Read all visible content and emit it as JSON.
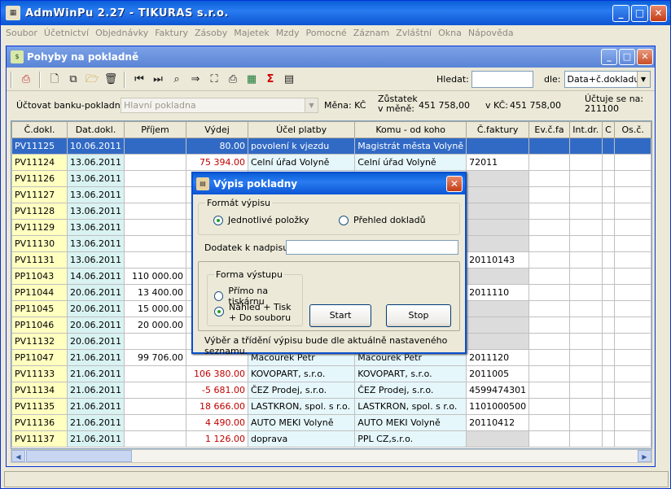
{
  "app": {
    "title": "AdmWinPu 2.27 - TIKURAS  s.r.o."
  },
  "menu": [
    "Soubor",
    "Účetnictví",
    "Objednávky",
    "Faktury",
    "Zásoby",
    "Majetek",
    "Mzdy",
    "Pomocné",
    "Záznam",
    "Zvláštní",
    "Okna",
    "Nápověda"
  ],
  "child": {
    "title": "Pohyby na pokladně"
  },
  "toolbar": {
    "search_label": "Hledat:",
    "search_value": "",
    "sort_label": "dle:",
    "sort_value": "Data+č.dokladu",
    "icons": [
      "print-icon",
      "new-doc-icon",
      "copy-icon",
      "open-folder-icon",
      "delete-icon",
      "first-record-icon",
      "last-record-icon",
      "find-icon",
      "goto-icon",
      "select-area-icon",
      "printer-icon",
      "excel-icon",
      "sum-icon",
      "grid-icon"
    ]
  },
  "info": {
    "account_label": "Účtovat banku-pokladnu:",
    "account_value": "Hlavní pokladna",
    "currency_label": "Měna: KČ",
    "balance_label_1": "Zůstatek",
    "balance_label_2": "v měně:",
    "balance_value": "451 758,00",
    "kc_label": "v KČ:",
    "kc_value": "451 758,00",
    "ucetni_label": "Účtuje se na:",
    "ucetni_value": "211100"
  },
  "table": {
    "columns": [
      "Č.dokl.",
      "Dat.dokl.",
      "Příjem",
      "Výdej",
      "Účel platby",
      "Komu - od koho",
      "Č.faktury",
      "Ev.č.fa",
      "Int.dr.",
      "C",
      "Os.č."
    ],
    "rows": [
      {
        "dokl": "PV11125",
        "dat": "10.06.2011",
        "prijem": "",
        "vydej": "80.00",
        "ucel": "povolení k vjezdu",
        "komu": "Magistrát města Volyně",
        "cf": "",
        "neg": false
      },
      {
        "dokl": "PV11124",
        "dat": "13.06.2011",
        "prijem": "",
        "vydej": "75 394.00",
        "ucel": "Celní úřad Volyně",
        "komu": "Celní úřad Volyně",
        "cf": "72011",
        "neg": true
      },
      {
        "dokl": "PV11126",
        "dat": "13.06.2011",
        "prijem": "",
        "vydej": "",
        "ucel": "",
        "komu": "",
        "cf": "",
        "neg": false
      },
      {
        "dokl": "PV11127",
        "dat": "13.06.2011",
        "prijem": "",
        "vydej": "",
        "ucel": "",
        "komu": "",
        "cf": "",
        "neg": false
      },
      {
        "dokl": "PV11128",
        "dat": "13.06.2011",
        "prijem": "",
        "vydej": "",
        "ucel": "",
        "komu": "",
        "cf": "",
        "neg": false
      },
      {
        "dokl": "PV11129",
        "dat": "13.06.2011",
        "prijem": "",
        "vydej": "",
        "ucel": "",
        "komu": "",
        "cf": "",
        "neg": false
      },
      {
        "dokl": "PV11130",
        "dat": "13.06.2011",
        "prijem": "",
        "vydej": "",
        "ucel": "",
        "komu": "",
        "cf": "",
        "neg": false
      },
      {
        "dokl": "PV11131",
        "dat": "13.06.2011",
        "prijem": "",
        "vydej": "",
        "ucel": "",
        "komu": "",
        "cf": "20110143",
        "neg": false
      },
      {
        "dokl": "PP11043",
        "dat": "14.06.2011",
        "prijem": "110 000.00",
        "vydej": "",
        "ucel": "",
        "komu": "",
        "cf": "",
        "neg": false
      },
      {
        "dokl": "PP11044",
        "dat": "20.06.2011",
        "prijem": "13 400.00",
        "vydej": "",
        "ucel": "",
        "komu": "",
        "cf": "2011110",
        "neg": false
      },
      {
        "dokl": "PP11045",
        "dat": "20.06.2011",
        "prijem": "15 000.00",
        "vydej": "",
        "ucel": "",
        "komu": "",
        "cf": "",
        "neg": false
      },
      {
        "dokl": "PP11046",
        "dat": "20.06.2011",
        "prijem": "20 000.00",
        "vydej": "",
        "ucel": "",
        "komu": "",
        "cf": "",
        "neg": false
      },
      {
        "dokl": "PV11132",
        "dat": "20.06.2011",
        "prijem": "",
        "vydej": "",
        "ucel": "",
        "komu": "",
        "cf": "",
        "neg": false
      },
      {
        "dokl": "PP11047",
        "dat": "21.06.2011",
        "prijem": "99 706.00",
        "vydej": "",
        "ucel": "Macourek Petr",
        "komu": "Macourek Petr",
        "cf": "2011120",
        "neg": false
      },
      {
        "dokl": "PV11133",
        "dat": "21.06.2011",
        "prijem": "",
        "vydej": "106 380.00",
        "ucel": "KOVOPART, s.r.o.",
        "komu": "KOVOPART, s.r.o.",
        "cf": "2011005",
        "neg": true
      },
      {
        "dokl": "PV11134",
        "dat": "21.06.2011",
        "prijem": "",
        "vydej": "-5 681.00",
        "ucel": "ČEZ Prodej, s.r.o.",
        "komu": "ČEZ Prodej, s.r.o.",
        "cf": "4599474301",
        "neg": true
      },
      {
        "dokl": "PV11135",
        "dat": "21.06.2011",
        "prijem": "",
        "vydej": "18 666.00",
        "ucel": "LASTKRON, spol. s r.o.",
        "komu": "LASTKRON, spol. s r.o.",
        "cf": "1101000500",
        "neg": true
      },
      {
        "dokl": "PV11136",
        "dat": "21.06.2011",
        "prijem": "",
        "vydej": "4 490.00",
        "ucel": "AUTO MEKI Volyně",
        "komu": "AUTO MEKI Volyně",
        "cf": "20110412",
        "neg": true
      },
      {
        "dokl": "PV11137",
        "dat": "21.06.2011",
        "prijem": "",
        "vydej": "1 126.00",
        "ucel": "doprava",
        "komu": "PPL CZ,s.r.o.",
        "cf": "",
        "neg": true
      }
    ]
  },
  "dialog": {
    "title": "Výpis pokladny",
    "format_group": "Formát výpisu",
    "opt_items": "Jednotlivé položky",
    "opt_overview": "Přehled dokladů",
    "append_label": "Dodatek k nadpisu:",
    "append_value": "",
    "output_group": "Forma výstupu",
    "opt_printer": "Přímo na tiskárnu",
    "opt_preview_1": "Náhled + Tisk",
    "opt_preview_2": "+ Do souboru",
    "start_label": "Start",
    "stop_label": "Stop",
    "note": "Výběr a třídění výpisu bude dle aktuálně nastaveného seznamu."
  }
}
